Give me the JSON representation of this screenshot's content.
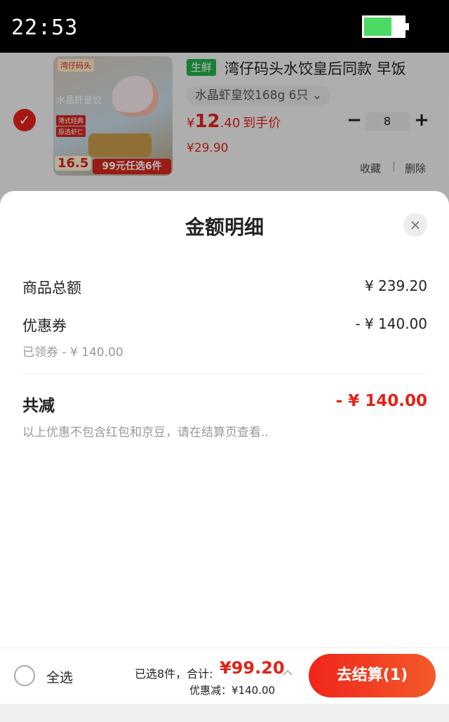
{
  "status_bar": {
    "time": "22:53",
    "battery_level": 0.7
  },
  "product": {
    "selected": true,
    "image": {
      "brand": "湾仔码头",
      "name_overlay": "水晶虾皇饺",
      "tag_1": "港式经典",
      "tag_2": "原选虾仁",
      "badge_price": "16.5",
      "promo": "99元任选6件"
    },
    "badge": "生鲜",
    "title": "湾仔码头水饺皇后同款 早饭",
    "spec": "水晶虾皇饺168g 6只 ⌄",
    "price_symbol": "¥",
    "price_int": "12",
    "price_dec": ".40",
    "price_label": "到手价",
    "original_price": "¥29.90",
    "qty_minus": "−",
    "quantity": "8",
    "qty_plus": "+",
    "collect": "收藏",
    "separator": "|",
    "delete": "删除"
  },
  "sheet": {
    "title": "金额明细",
    "close_icon": "×",
    "rows": {
      "goods_total_label": "商品总额",
      "goods_total_value": "¥ 239.20",
      "coupon_label": "优惠券",
      "coupon_value": "- ¥ 140.00",
      "coupon_note": "已领券 - ¥ 140.00"
    },
    "total_discount_label": "共减",
    "total_discount_value": "- ¥ 140.00",
    "disclaimer": "以上优惠不包含红包和京豆，请在结算页查看.."
  },
  "bottom_bar": {
    "select_all": "全选",
    "selected_info": "已选8件，合计:",
    "total_price": "¥99.20",
    "discount_info": "优惠减：¥140.00",
    "checkout": "去结算(1)"
  },
  "colors": {
    "accent": "#e2231a",
    "fresh": "#1fb04a",
    "battery": "#4cd964"
  }
}
